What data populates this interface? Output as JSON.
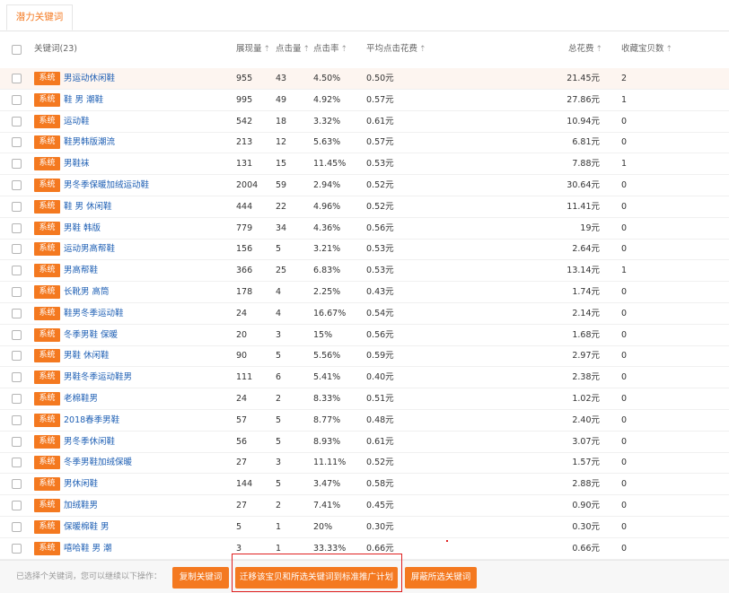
{
  "tab": {
    "label": "潜力关键词"
  },
  "header": {
    "keyword": "关键词(23)",
    "impressions": "展现量",
    "clicks": "点击量",
    "ctr": "点击率",
    "avg_cpc": "平均点击花费",
    "total_cost": "总花费",
    "favorites": "收藏宝贝数",
    "sort_icon": "sort-arrow-icon"
  },
  "rows": [
    {
      "tag": "系统",
      "keyword": "男运动休闲鞋",
      "impressions": "955",
      "clicks": "43",
      "ctr": "4.50%",
      "cpc": "0.50元",
      "cost": "21.45元",
      "fav": "2"
    },
    {
      "tag": "系统",
      "keyword": "鞋 男 潮鞋",
      "impressions": "995",
      "clicks": "49",
      "ctr": "4.92%",
      "cpc": "0.57元",
      "cost": "27.86元",
      "fav": "1"
    },
    {
      "tag": "系统",
      "keyword": "运动鞋",
      "impressions": "542",
      "clicks": "18",
      "ctr": "3.32%",
      "cpc": "0.61元",
      "cost": "10.94元",
      "fav": "0"
    },
    {
      "tag": "系统",
      "keyword": "鞋男韩版潮流",
      "impressions": "213",
      "clicks": "12",
      "ctr": "5.63%",
      "cpc": "0.57元",
      "cost": "6.81元",
      "fav": "0"
    },
    {
      "tag": "系统",
      "keyword": "男鞋袜",
      "impressions": "131",
      "clicks": "15",
      "ctr": "11.45%",
      "cpc": "0.53元",
      "cost": "7.88元",
      "fav": "1"
    },
    {
      "tag": "系统",
      "keyword": "男冬季保暖加绒运动鞋",
      "impressions": "2004",
      "clicks": "59",
      "ctr": "2.94%",
      "cpc": "0.52元",
      "cost": "30.64元",
      "fav": "0"
    },
    {
      "tag": "系统",
      "keyword": "鞋 男 休闲鞋",
      "impressions": "444",
      "clicks": "22",
      "ctr": "4.96%",
      "cpc": "0.52元",
      "cost": "11.41元",
      "fav": "0"
    },
    {
      "tag": "系统",
      "keyword": "男鞋 韩版",
      "impressions": "779",
      "clicks": "34",
      "ctr": "4.36%",
      "cpc": "0.56元",
      "cost": "19元",
      "fav": "0"
    },
    {
      "tag": "系统",
      "keyword": "运动男高帮鞋",
      "impressions": "156",
      "clicks": "5",
      "ctr": "3.21%",
      "cpc": "0.53元",
      "cost": "2.64元",
      "fav": "0"
    },
    {
      "tag": "系统",
      "keyword": "男高帮鞋",
      "impressions": "366",
      "clicks": "25",
      "ctr": "6.83%",
      "cpc": "0.53元",
      "cost": "13.14元",
      "fav": "1"
    },
    {
      "tag": "系统",
      "keyword": "长靴男 高筒",
      "impressions": "178",
      "clicks": "4",
      "ctr": "2.25%",
      "cpc": "0.43元",
      "cost": "1.74元",
      "fav": "0"
    },
    {
      "tag": "系统",
      "keyword": "鞋男冬季运动鞋",
      "impressions": "24",
      "clicks": "4",
      "ctr": "16.67%",
      "cpc": "0.54元",
      "cost": "2.14元",
      "fav": "0"
    },
    {
      "tag": "系统",
      "keyword": "冬季男鞋 保暖",
      "impressions": "20",
      "clicks": "3",
      "ctr": "15%",
      "cpc": "0.56元",
      "cost": "1.68元",
      "fav": "0"
    },
    {
      "tag": "系统",
      "keyword": "男鞋 休闲鞋",
      "impressions": "90",
      "clicks": "5",
      "ctr": "5.56%",
      "cpc": "0.59元",
      "cost": "2.97元",
      "fav": "0"
    },
    {
      "tag": "系统",
      "keyword": "男鞋冬季运动鞋男",
      "impressions": "111",
      "clicks": "6",
      "ctr": "5.41%",
      "cpc": "0.40元",
      "cost": "2.38元",
      "fav": "0"
    },
    {
      "tag": "系统",
      "keyword": "老棉鞋男",
      "impressions": "24",
      "clicks": "2",
      "ctr": "8.33%",
      "cpc": "0.51元",
      "cost": "1.02元",
      "fav": "0"
    },
    {
      "tag": "系统",
      "keyword": "2018春季男鞋",
      "impressions": "57",
      "clicks": "5",
      "ctr": "8.77%",
      "cpc": "0.48元",
      "cost": "2.40元",
      "fav": "0"
    },
    {
      "tag": "系统",
      "keyword": "男冬季休闲鞋",
      "impressions": "56",
      "clicks": "5",
      "ctr": "8.93%",
      "cpc": "0.61元",
      "cost": "3.07元",
      "fav": "0"
    },
    {
      "tag": "系统",
      "keyword": "冬季男鞋加绒保暖",
      "impressions": "27",
      "clicks": "3",
      "ctr": "11.11%",
      "cpc": "0.52元",
      "cost": "1.57元",
      "fav": "0"
    },
    {
      "tag": "系统",
      "keyword": "男休闲鞋",
      "impressions": "144",
      "clicks": "5",
      "ctr": "3.47%",
      "cpc": "0.58元",
      "cost": "2.88元",
      "fav": "0"
    },
    {
      "tag": "系统",
      "keyword": "加绒鞋男",
      "impressions": "27",
      "clicks": "2",
      "ctr": "7.41%",
      "cpc": "0.45元",
      "cost": "0.90元",
      "fav": "0"
    },
    {
      "tag": "系统",
      "keyword": "保暖棉鞋 男",
      "impressions": "5",
      "clicks": "1",
      "ctr": "20%",
      "cpc": "0.30元",
      "cost": "0.30元",
      "fav": "0"
    },
    {
      "tag": "系统",
      "keyword": "嘻哈鞋 男 潮",
      "impressions": "3",
      "clicks": "1",
      "ctr": "33.33%",
      "cpc": "0.66元",
      "cost": "0.66元",
      "fav": "0"
    }
  ],
  "footer": {
    "selected_text": "已选择个关键词，您可以继续以下操作：",
    "copy_button": "复制关键词",
    "move_button": "迁移该宝贝和所选关键词到标准推广计划",
    "block_button": "屏蔽所选关键词"
  },
  "colors": {
    "accent": "#f47920",
    "link": "#1e5fb4",
    "highlight_frame": "#e02020"
  }
}
